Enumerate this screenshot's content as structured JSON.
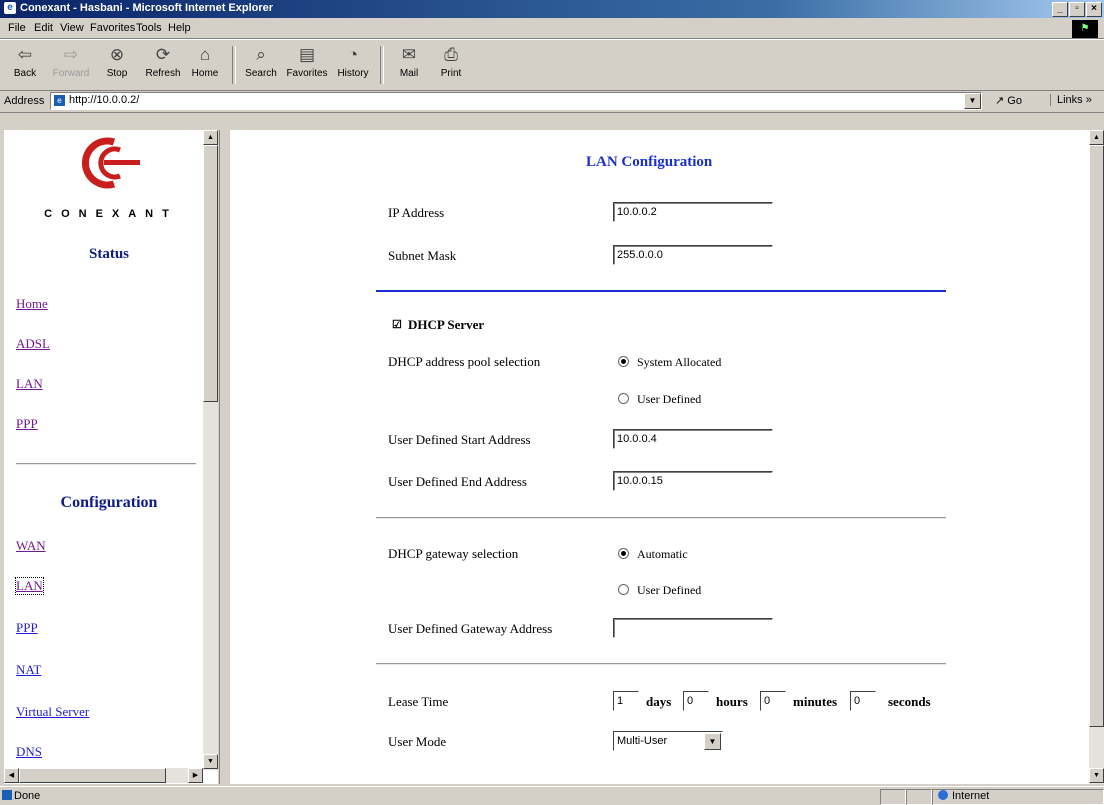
{
  "window": {
    "title": "Conexant - Hasbani - Microsoft Internet Explorer"
  },
  "menu": [
    "File",
    "Edit",
    "View",
    "Favorites",
    "Tools",
    "Help"
  ],
  "toolbar": {
    "back": "Back",
    "forward": "Forward",
    "stop": "Stop",
    "refresh": "Refresh",
    "home": "Home",
    "search": "Search",
    "favorites": "Favorites",
    "history": "History",
    "mail": "Mail",
    "print": "Print"
  },
  "address": {
    "label": "Address",
    "url": "http://10.0.0.2/",
    "go": "Go",
    "links": "Links »"
  },
  "sidebar": {
    "brand": "CONEXANT",
    "status_heading": "Status",
    "status_links": [
      "Home",
      "ADSL",
      "LAN",
      "PPP"
    ],
    "config_heading": "Configuration",
    "config_links": [
      "WAN",
      "LAN",
      "PPP",
      "NAT",
      "Virtual Server",
      "DNS"
    ]
  },
  "main": {
    "title": "LAN Configuration",
    "ip_label": "IP Address",
    "ip_value": "10.0.0.2",
    "subnet_label": "Subnet Mask",
    "subnet_value": "255.0.0.0",
    "dhcp_server_label": "DHCP Server",
    "pool_label": "DHCP address pool selection",
    "pool_opt1": "System Allocated",
    "pool_opt2": "User Defined",
    "start_label": "User Defined Start Address",
    "start_value": "10.0.0.4",
    "end_label": "User Defined End Address",
    "end_value": "10.0.0.15",
    "gw_label": "DHCP gateway selection",
    "gw_opt1": "Automatic",
    "gw_opt2": "User Defined",
    "gw_addr_label": "User Defined Gateway Address",
    "gw_addr_value": "",
    "lease_label": "Lease Time",
    "lease_days": "1",
    "days": "days",
    "lease_hours": "0",
    "hours": "hours",
    "lease_minutes": "0",
    "minutes": "minutes",
    "lease_seconds": "0",
    "seconds": "seconds",
    "mode_label": "User Mode",
    "mode_value": "Multi-User"
  },
  "statusbar": {
    "text": "Done",
    "zone": "Internet"
  }
}
